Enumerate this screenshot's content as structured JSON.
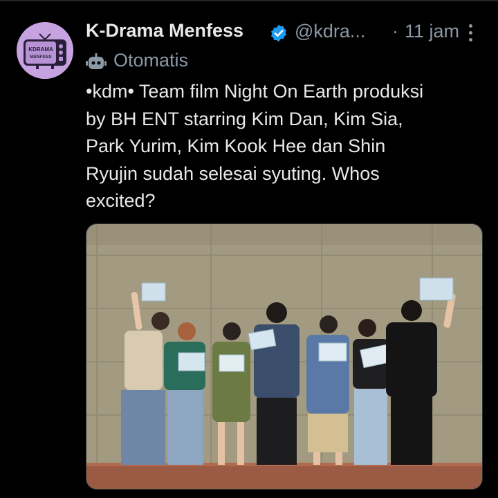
{
  "post": {
    "author": {
      "display_name": "K-Drama Menfess",
      "handle": "@kdra...",
      "verified": true,
      "avatar_text_line1": "KDRAMA",
      "avatar_text_line2": "MENFESS"
    },
    "separator": "·",
    "time": "11 jam",
    "automated_label": "Otomatis",
    "text_lines": [
      "•kdm• Team film Night On Earth produksi",
      "by BH ENT starring Kim Dan, Kim Sia,",
      "Park Yurim, Kim Kook Hee dan Shin",
      "Ryujin sudah selesai syuting. Whos",
      "excited?"
    ],
    "media": {
      "type": "photo",
      "people_count": 7
    }
  },
  "icons": {
    "verified": "verified-badge-icon",
    "more": "more-options-icon",
    "automated": "robot-icon"
  },
  "colors": {
    "background": "#000000",
    "primary_text": "#e7e9ea",
    "secondary_text": "#8b98a5",
    "verified_blue": "#1d9bf0",
    "avatar_bg": "#c6a2e0"
  }
}
